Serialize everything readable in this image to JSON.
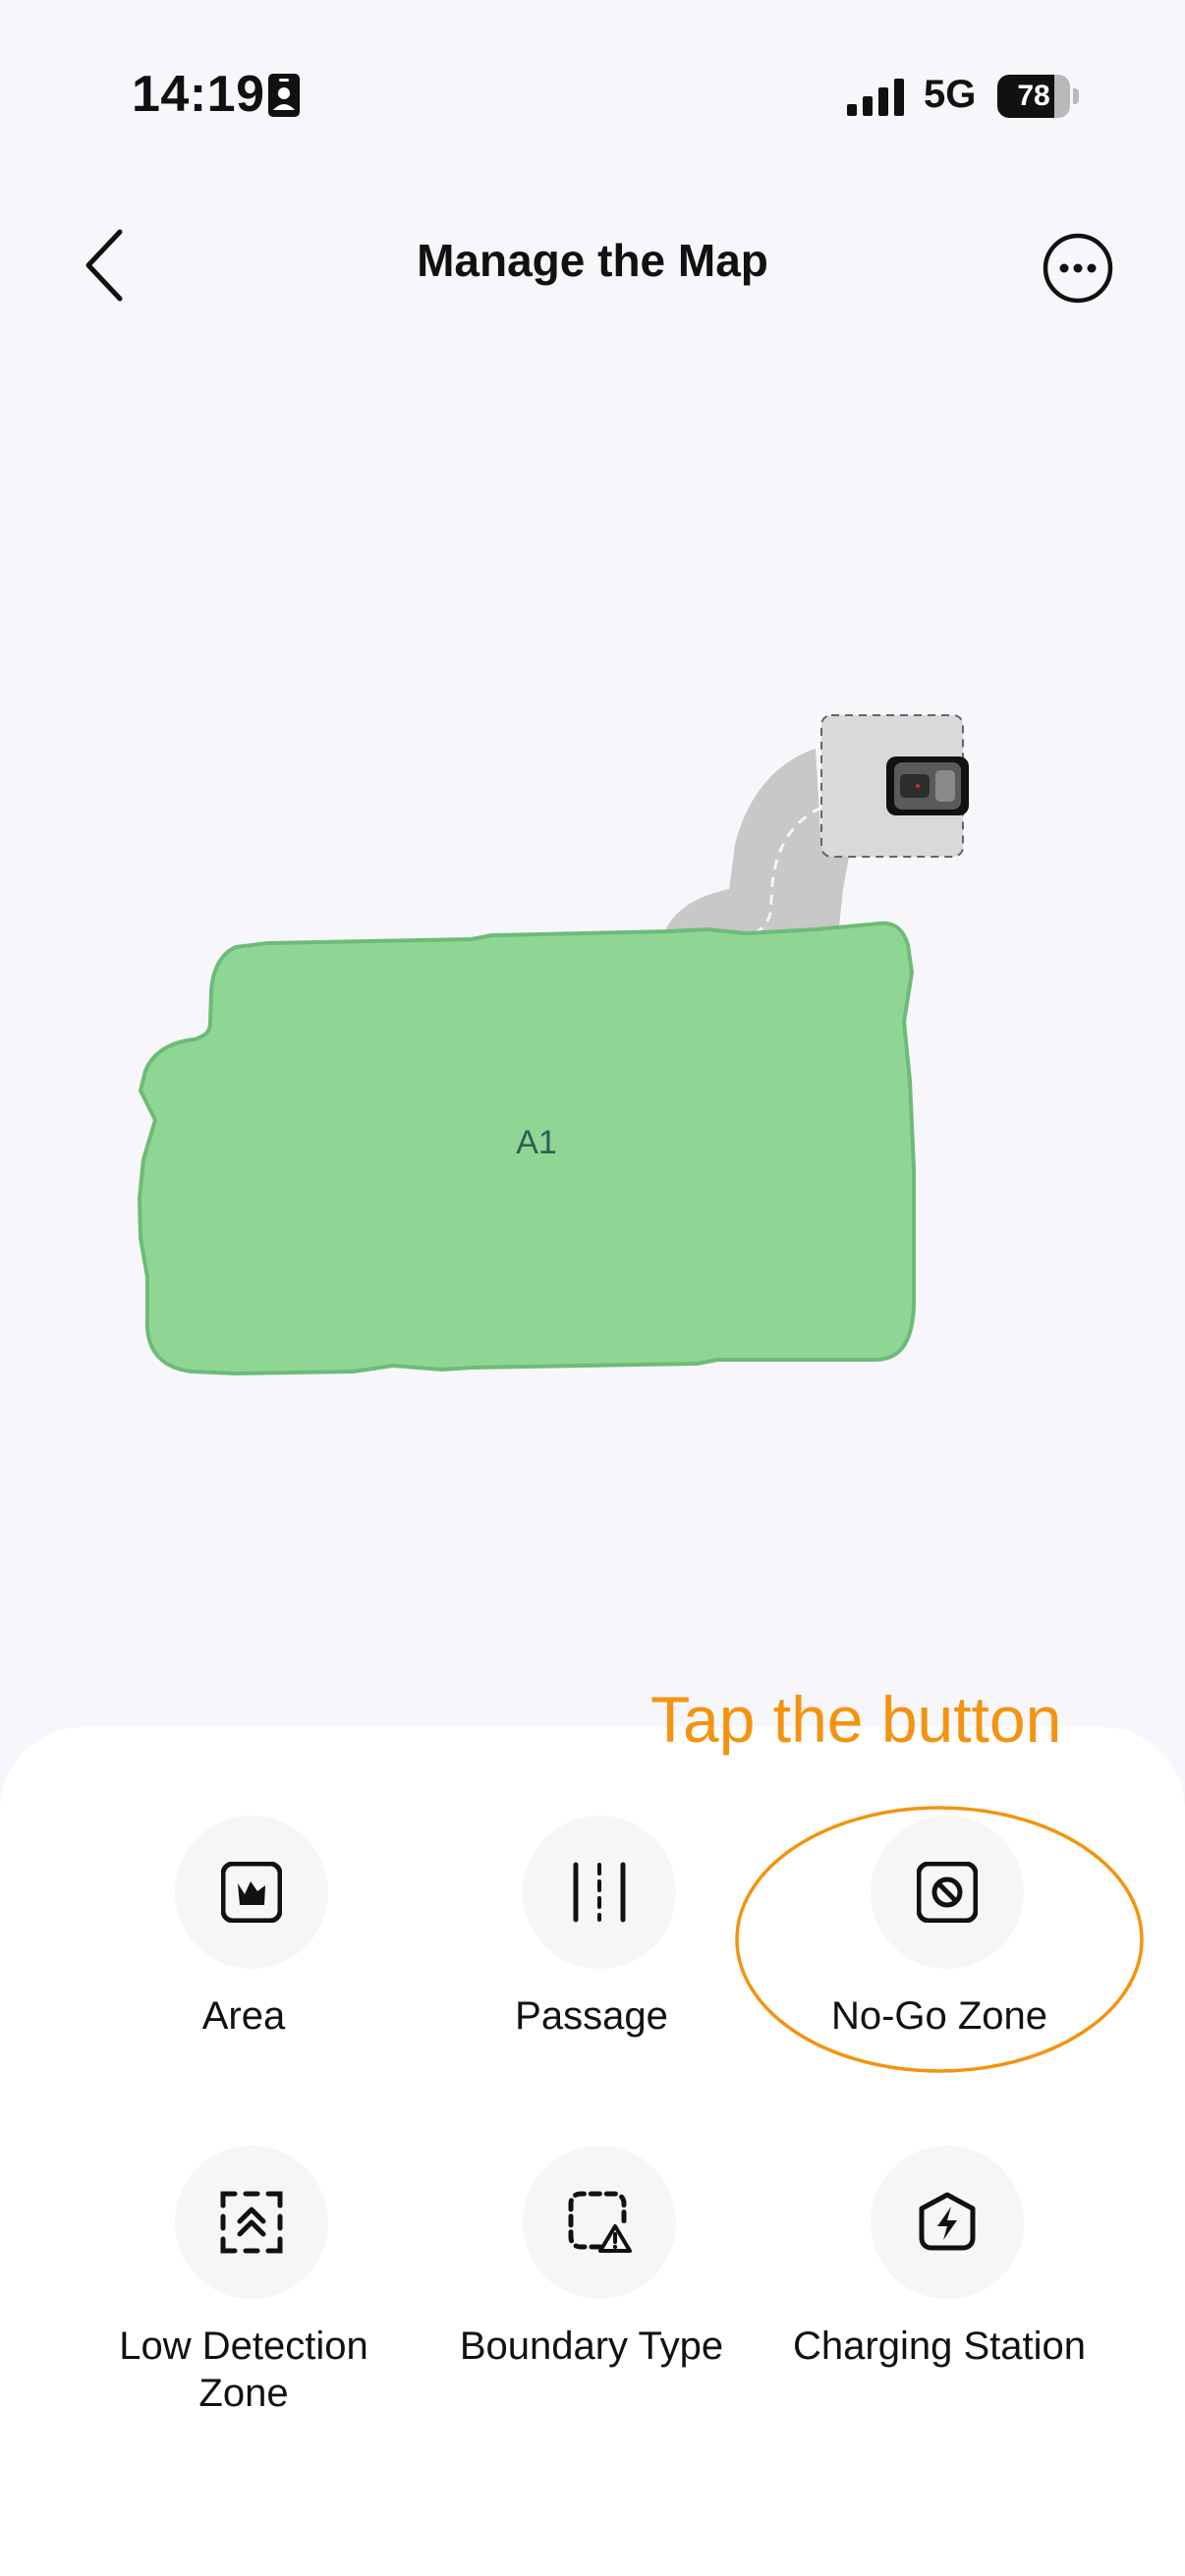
{
  "status_bar": {
    "time": "14:19",
    "network": "5G",
    "battery_level": "78",
    "battery_fraction": 0.78
  },
  "header": {
    "title": "Manage the Map"
  },
  "map": {
    "area_label": "A1",
    "colors": {
      "area_fill": "#8fd694",
      "area_stroke": "#6dbb77",
      "passage": "#c8c8c8",
      "station_zone": "#d9d9d9"
    }
  },
  "annotation": {
    "text": "Tap the button",
    "color": "#f4930f"
  },
  "tools": [
    {
      "label": "Area",
      "icon": "area-icon"
    },
    {
      "label": "Passage",
      "icon": "passage-icon"
    },
    {
      "label": "No-Go Zone",
      "icon": "no-go-zone-icon"
    },
    {
      "label": "Low Detection Zone",
      "icon": "low-detection-zone-icon"
    },
    {
      "label": "Boundary Type",
      "icon": "boundary-type-icon"
    },
    {
      "label": "Charging Station",
      "icon": "charging-station-icon"
    }
  ]
}
